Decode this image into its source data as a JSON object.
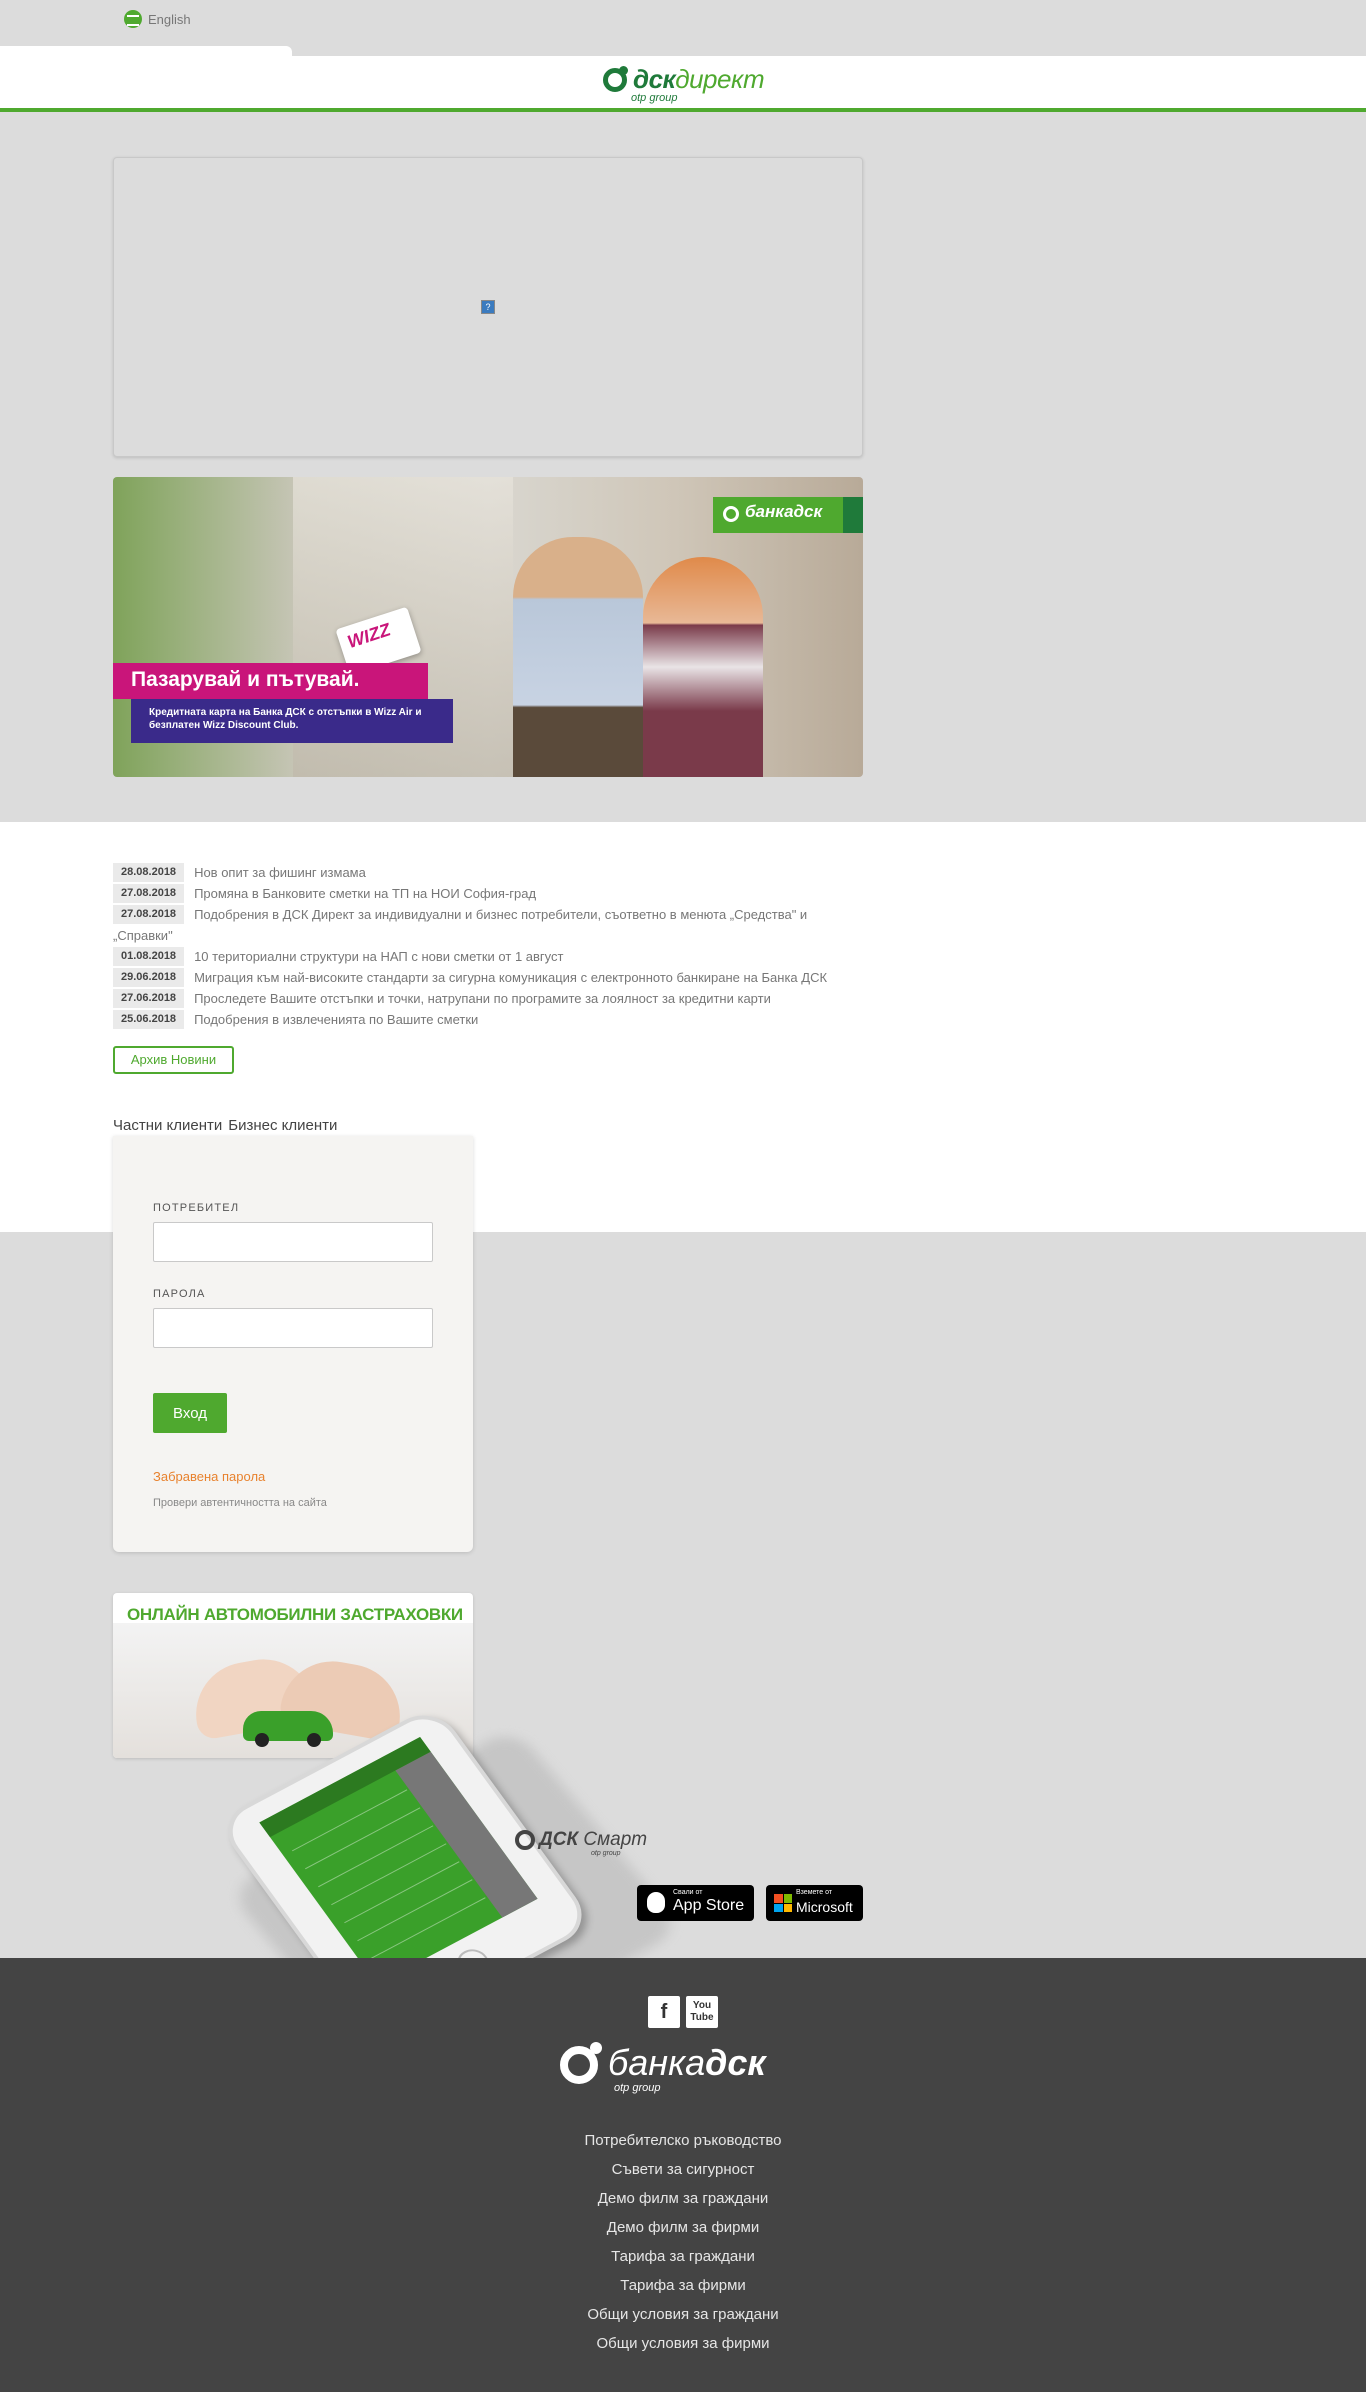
{
  "topbar": {
    "language_label": "English"
  },
  "header": {
    "logo_brand_dark": "дск",
    "logo_brand_light": "директ",
    "logo_sub": "otp group"
  },
  "iframe_placeholder": {
    "broken_icon": "?"
  },
  "promo_banner": {
    "bank_badge": "банкадск",
    "card_text": "WIZZ",
    "headline": "Пазарувай и пътувай.",
    "subtext": "Кредитната карта на Банка ДСК с отстъпки в Wizz Air и безплатен Wizz Discount Club."
  },
  "news": {
    "items": [
      {
        "date": "28.08.2018",
        "title": "Нов опит за фишинг измама"
      },
      {
        "date": "27.08.2018",
        "title": "Промяна в Банковите сметки на ТП на НОИ София-град"
      },
      {
        "date": "27.08.2018",
        "title": "Подобрения в ДСК Директ за индивидуални и бизнес потребители, съответно в менюта „Средства\" и",
        "continuation": "„Справки\""
      },
      {
        "date": "01.08.2018",
        "title": "10 териториални структури на НАП с нови сметки от 1 август"
      },
      {
        "date": "29.06.2018",
        "title": "Миграция към най-високите стандарти за сигурна комуникация с електронното банкиране на Банка ДСК"
      },
      {
        "date": "27.06.2018",
        "title": "Проследете Вашите отстъпки и точки, натрупани по програмите за лоялност за кредитни карти"
      },
      {
        "date": "25.06.2018",
        "title": "Подобрения в извлеченията по Вашите сметки"
      }
    ],
    "archive_button": "Архив Новини"
  },
  "login": {
    "tab_private": "Частни клиенти",
    "tab_business": "Бизнес клиенти",
    "user_label": "ПОТРЕБИТЕЛ",
    "user_value": "",
    "password_label": "ПАРОЛА",
    "password_value": "",
    "submit": "Вход",
    "forgot": "Забравена парола",
    "verify": "Провери автентичността на сайта"
  },
  "insurance_banner": {
    "headline": "ОНЛАЙН АВТОМОБИЛНИ ЗАСТРАХОВКИ"
  },
  "smart_app": {
    "logo_bold": "ДСК",
    "logo_text": " Смарт",
    "logo_sub": "otp group",
    "appstore_small": "Свали от",
    "appstore_big": "App Store",
    "ms_small": "Вземете от",
    "ms_big": "Microsoft"
  },
  "footer": {
    "social_fb": "f",
    "social_yt": "You Tube",
    "logo_light": "банка",
    "logo_bold": "дск",
    "logo_sub": "otp group",
    "links": [
      "Потребителско ръководство",
      "Съвети за сигурност",
      "Демо филм за граждани",
      "Демо филм за фирми",
      "Тарифа за граждани",
      "Тарифа за фирми",
      "Общи условия за граждани",
      "Общи условия за фирми"
    ]
  },
  "colors": {
    "brand_green": "#4fa92f",
    "dark_green": "#1f7a3a",
    "accent_orange": "#e8822e",
    "footer_bg": "#444444",
    "page_bg": "#dcdcdc"
  }
}
